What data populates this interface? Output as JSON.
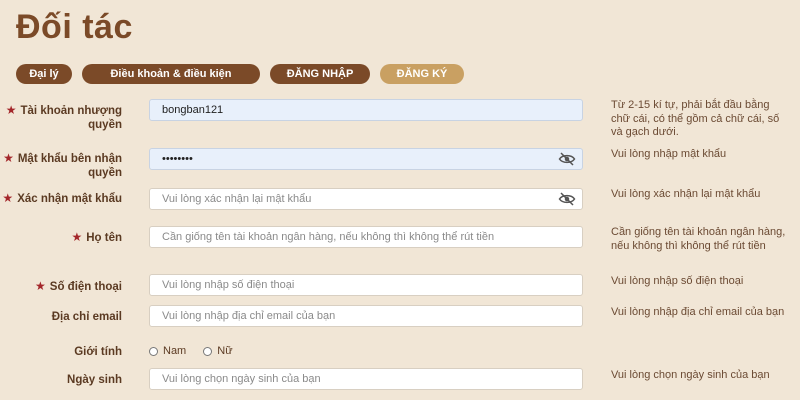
{
  "page": {
    "title": "Đối tác"
  },
  "tabs": [
    {
      "label": "Đại lý"
    },
    {
      "label": "Điều khoản & điều kiện"
    },
    {
      "label": "ĐĂNG NHẬP"
    },
    {
      "label": "ĐĂNG KÝ"
    }
  ],
  "form": {
    "account": {
      "label": "Tài khoản nhượng quyền",
      "value": "bongban121",
      "hint": "Từ 2-15 kí tự, phải bắt đầu bằng chữ cái, có thể gồm cả chữ cái, số và gạch dưới."
    },
    "password": {
      "label": "Mật khẩu bên nhận quyền",
      "value": "••••••••",
      "hint": "Vui lòng nhập mật khẩu"
    },
    "confirm": {
      "label": "Xác nhận mật khẩu",
      "placeholder": "Vui lòng xác nhận lại mật khẩu",
      "hint": "Vui lòng xác nhận lại mật khẩu"
    },
    "fullname": {
      "label": "Họ tên",
      "placeholder": "Cần giống tên tài khoản ngân hàng, nếu không thì không thể rút tiền",
      "hint": "Cần giống tên tài khoản ngân hàng, nếu không thì không thể rút tiền"
    },
    "phone": {
      "label": "Số điện thoại",
      "placeholder": "Vui lòng nhập số điện thoại",
      "hint": "Vui lòng nhập số điện thoại"
    },
    "email": {
      "label": "Địa chỉ email",
      "placeholder": "Vui lòng nhập địa chỉ email của bạn",
      "hint": "Vui lòng nhập địa chỉ email của bạn"
    },
    "gender": {
      "label": "Giới tính",
      "options": [
        "Nam",
        "Nữ"
      ]
    },
    "birthday": {
      "label": "Ngày sinh",
      "placeholder": "Vui lòng chọn ngày sinh của bạn",
      "hint": "Vui lòng chọn ngày sinh của bạn"
    }
  },
  "icons": {
    "required": "star-icon",
    "toggle_visibility": "eye-slash-icon"
  },
  "colors": {
    "primary": "#7b4a28",
    "active_tab": "#c9a062",
    "required": "#a3262a",
    "background": "#f1e6d6"
  }
}
